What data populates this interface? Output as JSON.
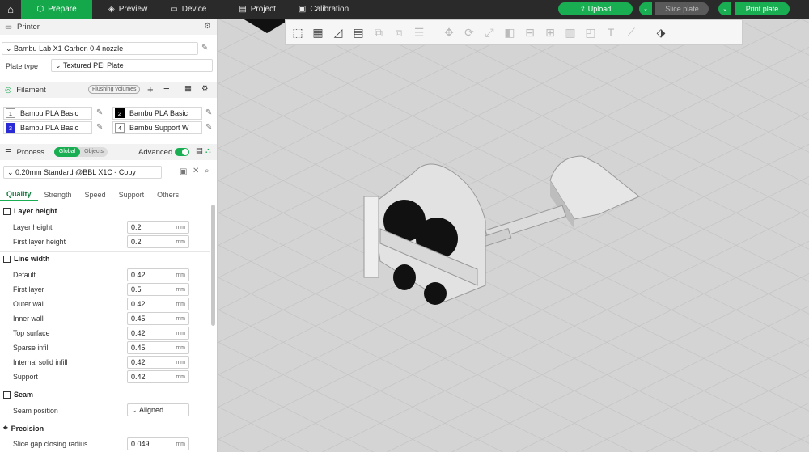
{
  "topbar": {
    "tabs": [
      {
        "label": "Prepare",
        "icon": "cube-icon"
      },
      {
        "label": "Preview",
        "icon": "layers-icon"
      },
      {
        "label": "Device",
        "icon": "monitor-icon"
      },
      {
        "label": "Project",
        "icon": "project-icon"
      },
      {
        "label": "Calibration",
        "icon": "calibration-icon"
      }
    ],
    "upload_label": "Upload",
    "slice_label": "Slice plate",
    "print_label": "Print plate"
  },
  "printer": {
    "header": "Printer",
    "model": "Bambu Lab X1 Carbon 0.4 nozzle",
    "plate_label": "Plate type",
    "plate_value": "Textured PEI Plate"
  },
  "filament": {
    "header": "Filament",
    "flushing": "Flushing volumes",
    "items": [
      {
        "num": "1",
        "name": "Bambu PLA Basic",
        "color": "#ffffff"
      },
      {
        "num": "2",
        "name": "Bambu PLA Basic",
        "color": "#000000"
      },
      {
        "num": "3",
        "name": "Bambu PLA Basic",
        "color": "#2b2bd6"
      },
      {
        "num": "4",
        "name": "Bambu Support W",
        "color": "#ffffff"
      }
    ]
  },
  "process": {
    "header": "Process",
    "toggle_global": "Global",
    "toggle_objects": "Objects",
    "advanced": "Advanced",
    "preset": "0.20mm Standard @BBL X1C - Copy",
    "tabs": [
      "Quality",
      "Strength",
      "Speed",
      "Support",
      "Others"
    ]
  },
  "settings": {
    "layer_height_group": "Layer height",
    "layer_height": {
      "label": "Layer height",
      "value": "0.2"
    },
    "first_layer_height": {
      "label": "First layer height",
      "value": "0.2"
    },
    "line_width_group": "Line width",
    "default": {
      "label": "Default",
      "value": "0.42"
    },
    "first_layer": {
      "label": "First layer",
      "value": "0.5"
    },
    "outer_wall": {
      "label": "Outer wall",
      "value": "0.42"
    },
    "inner_wall": {
      "label": "Inner wall",
      "value": "0.45"
    },
    "top_surface": {
      "label": "Top surface",
      "value": "0.42"
    },
    "sparse_infill": {
      "label": "Sparse infill",
      "value": "0.45"
    },
    "internal_solid_infill": {
      "label": "Internal solid infill",
      "value": "0.42"
    },
    "support": {
      "label": "Support",
      "value": "0.42"
    },
    "seam_group": "Seam",
    "seam_position": {
      "label": "Seam position",
      "value": "Aligned"
    },
    "precision_group": "Precision",
    "slice_gap": {
      "label": "Slice gap closing radius",
      "value": "0.049"
    },
    "unit": "mm"
  },
  "colors": {
    "accent": "#19ae52",
    "topbar": "#2a2a2a"
  }
}
